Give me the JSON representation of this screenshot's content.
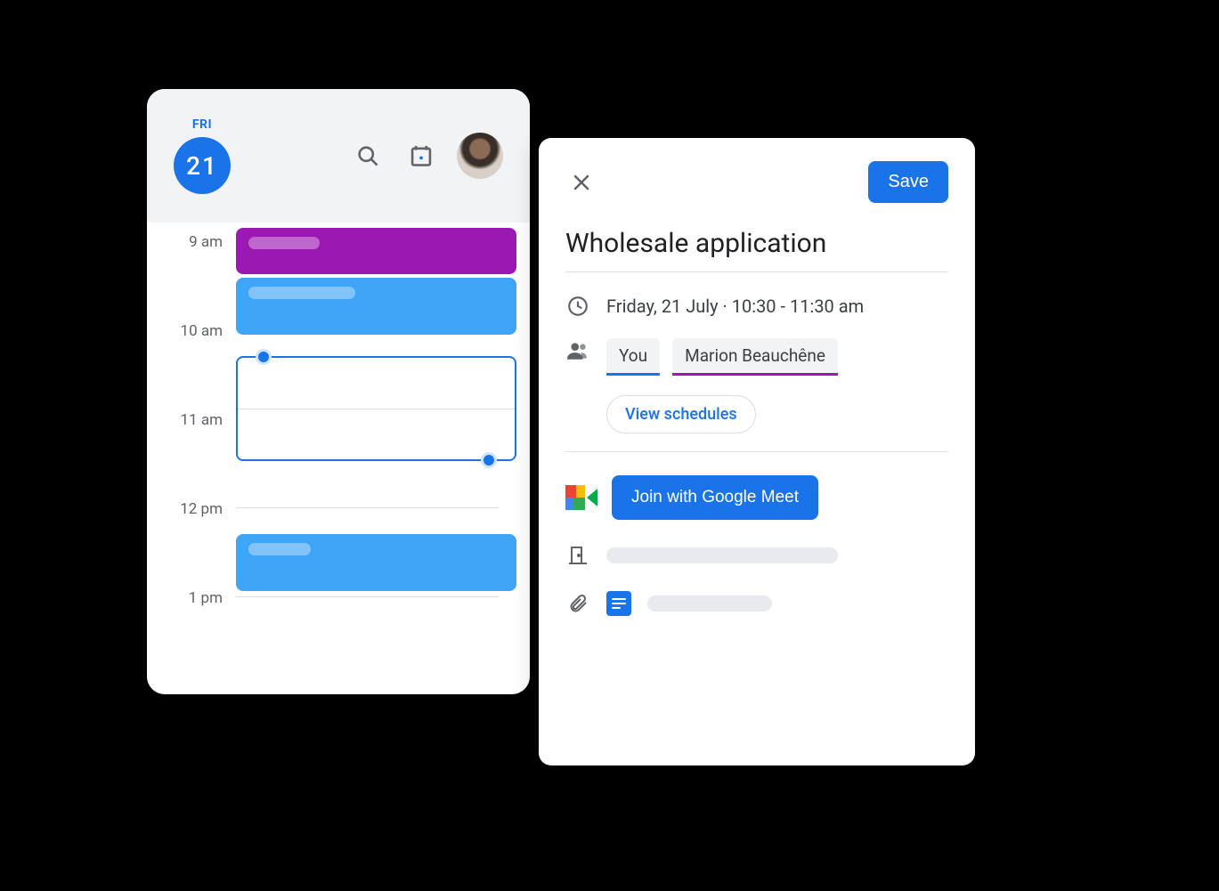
{
  "calendar": {
    "day_label": "FRI",
    "date_number": "21",
    "hours": [
      "9 am",
      "10 am",
      "11 am",
      "12 pm",
      "1 pm"
    ]
  },
  "event": {
    "save_label": "Save",
    "title": "Wholesale application",
    "datetime_text": "Friday, 21 July  ·  10:30 - 11:30 am",
    "people": {
      "you_label": "You",
      "guest_label": "Marion Beauchêne"
    },
    "view_schedules_label": "View schedules",
    "join_meet_label": "Join with Google Meet"
  }
}
